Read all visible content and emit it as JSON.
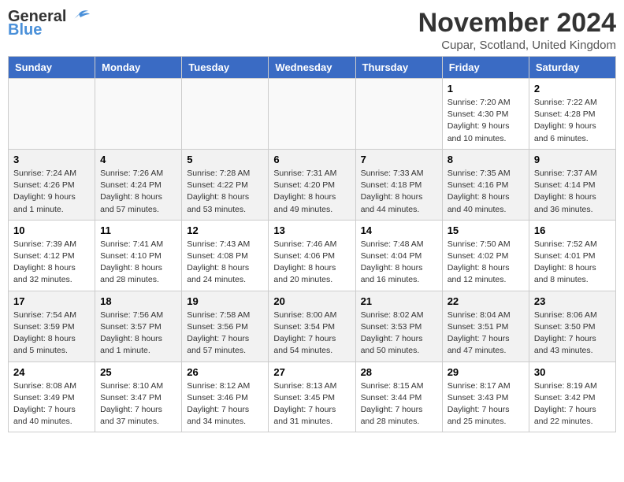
{
  "header": {
    "logo_general": "General",
    "logo_blue": "Blue",
    "month_title": "November 2024",
    "location": "Cupar, Scotland, United Kingdom"
  },
  "weekdays": [
    "Sunday",
    "Monday",
    "Tuesday",
    "Wednesday",
    "Thursday",
    "Friday",
    "Saturday"
  ],
  "weeks": [
    [
      {
        "day": "",
        "info": ""
      },
      {
        "day": "",
        "info": ""
      },
      {
        "day": "",
        "info": ""
      },
      {
        "day": "",
        "info": ""
      },
      {
        "day": "",
        "info": ""
      },
      {
        "day": "1",
        "info": "Sunrise: 7:20 AM\nSunset: 4:30 PM\nDaylight: 9 hours and 10 minutes."
      },
      {
        "day": "2",
        "info": "Sunrise: 7:22 AM\nSunset: 4:28 PM\nDaylight: 9 hours and 6 minutes."
      }
    ],
    [
      {
        "day": "3",
        "info": "Sunrise: 7:24 AM\nSunset: 4:26 PM\nDaylight: 9 hours and 1 minute."
      },
      {
        "day": "4",
        "info": "Sunrise: 7:26 AM\nSunset: 4:24 PM\nDaylight: 8 hours and 57 minutes."
      },
      {
        "day": "5",
        "info": "Sunrise: 7:28 AM\nSunset: 4:22 PM\nDaylight: 8 hours and 53 minutes."
      },
      {
        "day": "6",
        "info": "Sunrise: 7:31 AM\nSunset: 4:20 PM\nDaylight: 8 hours and 49 minutes."
      },
      {
        "day": "7",
        "info": "Sunrise: 7:33 AM\nSunset: 4:18 PM\nDaylight: 8 hours and 44 minutes."
      },
      {
        "day": "8",
        "info": "Sunrise: 7:35 AM\nSunset: 4:16 PM\nDaylight: 8 hours and 40 minutes."
      },
      {
        "day": "9",
        "info": "Sunrise: 7:37 AM\nSunset: 4:14 PM\nDaylight: 8 hours and 36 minutes."
      }
    ],
    [
      {
        "day": "10",
        "info": "Sunrise: 7:39 AM\nSunset: 4:12 PM\nDaylight: 8 hours and 32 minutes."
      },
      {
        "day": "11",
        "info": "Sunrise: 7:41 AM\nSunset: 4:10 PM\nDaylight: 8 hours and 28 minutes."
      },
      {
        "day": "12",
        "info": "Sunrise: 7:43 AM\nSunset: 4:08 PM\nDaylight: 8 hours and 24 minutes."
      },
      {
        "day": "13",
        "info": "Sunrise: 7:46 AM\nSunset: 4:06 PM\nDaylight: 8 hours and 20 minutes."
      },
      {
        "day": "14",
        "info": "Sunrise: 7:48 AM\nSunset: 4:04 PM\nDaylight: 8 hours and 16 minutes."
      },
      {
        "day": "15",
        "info": "Sunrise: 7:50 AM\nSunset: 4:02 PM\nDaylight: 8 hours and 12 minutes."
      },
      {
        "day": "16",
        "info": "Sunrise: 7:52 AM\nSunset: 4:01 PM\nDaylight: 8 hours and 8 minutes."
      }
    ],
    [
      {
        "day": "17",
        "info": "Sunrise: 7:54 AM\nSunset: 3:59 PM\nDaylight: 8 hours and 5 minutes."
      },
      {
        "day": "18",
        "info": "Sunrise: 7:56 AM\nSunset: 3:57 PM\nDaylight: 8 hours and 1 minute."
      },
      {
        "day": "19",
        "info": "Sunrise: 7:58 AM\nSunset: 3:56 PM\nDaylight: 7 hours and 57 minutes."
      },
      {
        "day": "20",
        "info": "Sunrise: 8:00 AM\nSunset: 3:54 PM\nDaylight: 7 hours and 54 minutes."
      },
      {
        "day": "21",
        "info": "Sunrise: 8:02 AM\nSunset: 3:53 PM\nDaylight: 7 hours and 50 minutes."
      },
      {
        "day": "22",
        "info": "Sunrise: 8:04 AM\nSunset: 3:51 PM\nDaylight: 7 hours and 47 minutes."
      },
      {
        "day": "23",
        "info": "Sunrise: 8:06 AM\nSunset: 3:50 PM\nDaylight: 7 hours and 43 minutes."
      }
    ],
    [
      {
        "day": "24",
        "info": "Sunrise: 8:08 AM\nSunset: 3:49 PM\nDaylight: 7 hours and 40 minutes."
      },
      {
        "day": "25",
        "info": "Sunrise: 8:10 AM\nSunset: 3:47 PM\nDaylight: 7 hours and 37 minutes."
      },
      {
        "day": "26",
        "info": "Sunrise: 8:12 AM\nSunset: 3:46 PM\nDaylight: 7 hours and 34 minutes."
      },
      {
        "day": "27",
        "info": "Sunrise: 8:13 AM\nSunset: 3:45 PM\nDaylight: 7 hours and 31 minutes."
      },
      {
        "day": "28",
        "info": "Sunrise: 8:15 AM\nSunset: 3:44 PM\nDaylight: 7 hours and 28 minutes."
      },
      {
        "day": "29",
        "info": "Sunrise: 8:17 AM\nSunset: 3:43 PM\nDaylight: 7 hours and 25 minutes."
      },
      {
        "day": "30",
        "info": "Sunrise: 8:19 AM\nSunset: 3:42 PM\nDaylight: 7 hours and 22 minutes."
      }
    ]
  ]
}
